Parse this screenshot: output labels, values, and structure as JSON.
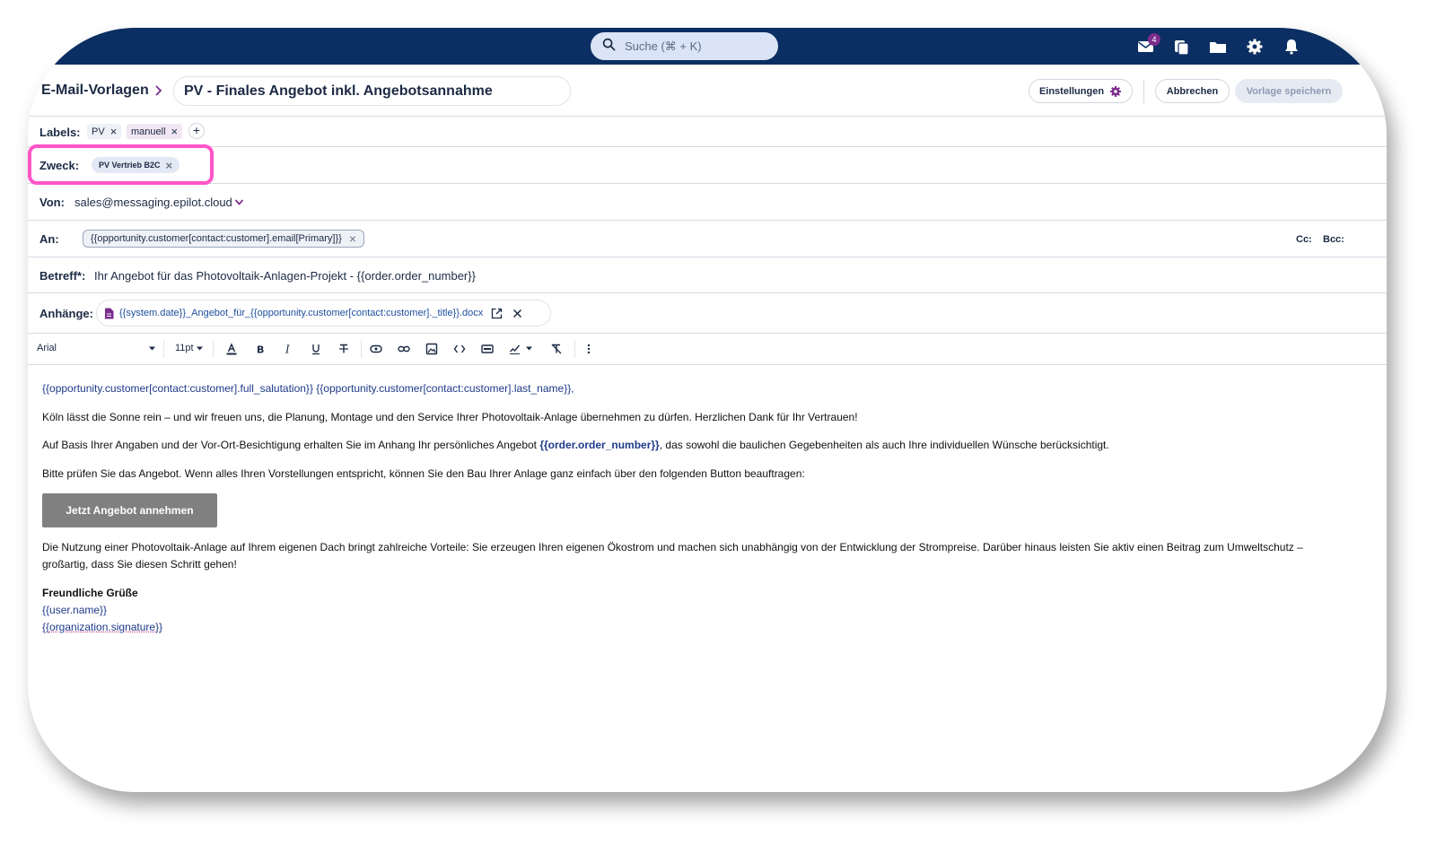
{
  "search": {
    "placeholder": "Suche (⌘ + K)"
  },
  "topbar": {
    "mail_badge": "4",
    "icons": [
      "mail-icon",
      "copy-icon",
      "folder-icon",
      "gear-icon",
      "bell-icon"
    ]
  },
  "header": {
    "breadcrumb": "E-Mail-Vorlagen",
    "title": "PV - Finales Angebot inkl. Angebotsannahme",
    "settings_label": "Einstellungen",
    "cancel_label": "Abbrechen",
    "save_label": "Vorlage speichern"
  },
  "labels": {
    "label": "Labels:",
    "items": [
      "PV",
      "manuell"
    ]
  },
  "purpose": {
    "label": "Zweck:",
    "value": "PV Vertrieb B2C"
  },
  "from": {
    "label": "Von:",
    "value": "sales@messaging.epilot.cloud"
  },
  "to": {
    "label": "An:",
    "value": "{{opportunity.customer[contact:customer].email[Primary]}}",
    "cc": "Cc:",
    "bcc": "Bcc:"
  },
  "subject": {
    "label": "Betreff*:",
    "value": "Ihr Angebot für das Photovoltaik-Anlagen-Projekt - {{order.order_number}}"
  },
  "attachments": {
    "label": "Anhänge:",
    "file": "{{system.date}}_Angebot_für_{{opportunity.customer[contact:customer]._title}}.docx"
  },
  "toolbar": {
    "font": "Arial",
    "size": "11pt"
  },
  "body": {
    "salutation": "{{opportunity.customer[contact:customer].full_salutation}} {{opportunity.customer[contact:customer].last_name}},",
    "p1": "Köln lässt die Sonne rein – und wir freuen uns, die Planung, Montage und den Service Ihrer Photovoltaik-Anlage übernehmen zu dürfen. Herzlichen Dank für Ihr Vertrauen!",
    "p2_before": "Auf Basis Ihrer Angaben und der Vor-Ort-Besichtigung erhalten Sie im Anhang Ihr persönliches Angebot ",
    "p2_var": "{{order.order_number}}",
    "p2_after": ", das sowohl die baulichen Gegebenheiten als auch Ihre individuellen Wünsche berücksichtigt.",
    "p3": "Bitte prüfen Sie das Angebot. Wenn alles Ihren Vorstellungen entspricht, können Sie den Bau Ihrer Anlage ganz einfach über den folgenden Button beauftragen:",
    "button": "Jetzt Angebot annehmen",
    "p4_line1": "Die Nutzung einer Photovoltaik-Anlage auf Ihrem eigenen Dach bringt zahlreiche Vorteile: Sie erzeugen Ihren eigenen Ökostrom und machen sich unabhängig von der Entwicklung der Strompreise. Darüber hinaus leisten Sie aktiv einen Beitrag zum Umweltschutz –",
    "p4_line2": "großartig, dass Sie diesen Schritt gehen!",
    "closing": "Freundliche Grüße",
    "user": "{{user.name}}",
    "signature": "{{organization.signature}}"
  }
}
